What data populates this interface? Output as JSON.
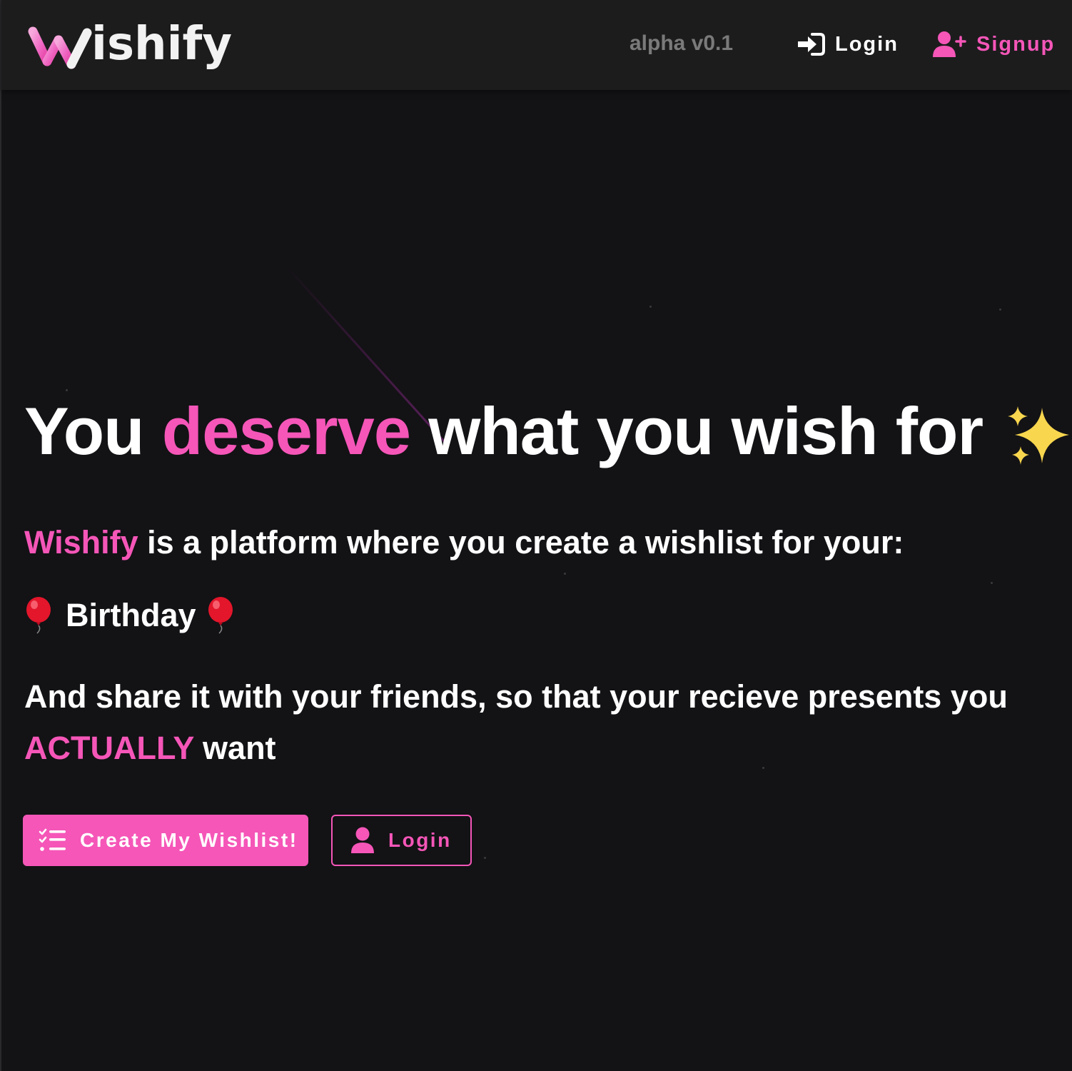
{
  "header": {
    "logo_text": "ishify",
    "logo_accessible_name": "Wishify",
    "version": "alpha v0.1",
    "login_label": "Login",
    "login_icon": "sign-in-icon",
    "signup_label": "Signup",
    "signup_icon": "user-plus-icon"
  },
  "hero": {
    "title_part1": "You ",
    "title_highlight": "deserve",
    "title_part2": " what you wish for",
    "title_emoji": "sparkles-icon",
    "description_brand": "Wishify",
    "description_rest": " is a platform where you create a wishlist for your:",
    "occasion": "Birthday",
    "occasion_emoji": "balloon-icon",
    "share_text": "And share it with your friends, so that your recieve presents you ",
    "share_highlight": "ACTUALLY",
    "share_end": " want"
  },
  "actions": {
    "create_label": "Create My Wishlist!",
    "create_icon": "checklist-icon",
    "login_label": "Login",
    "login_icon": "user-icon"
  },
  "colors": {
    "accent": "#f556b8",
    "background": "#131215",
    "header_bg": "#1c1c1d",
    "muted": "#7a7a7a"
  }
}
